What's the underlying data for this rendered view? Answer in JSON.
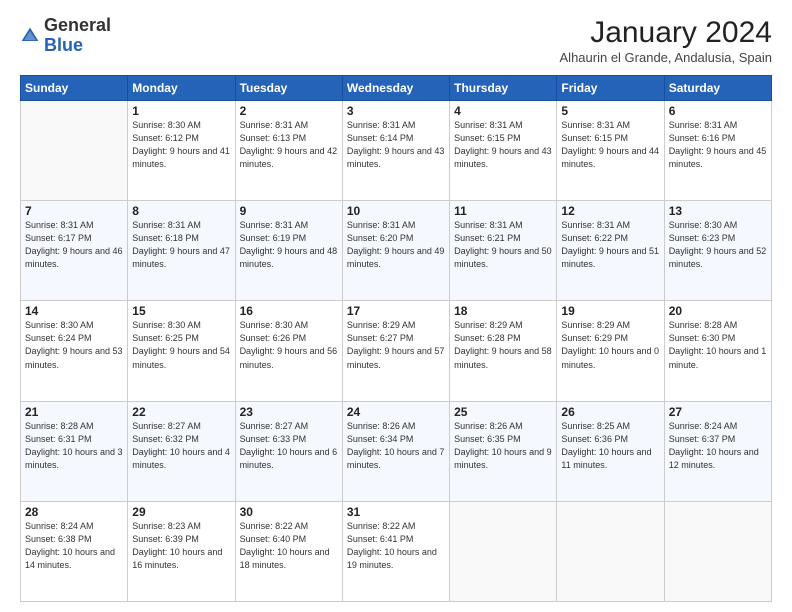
{
  "logo": {
    "general": "General",
    "blue": "Blue"
  },
  "header": {
    "month": "January 2024",
    "location": "Alhaurin el Grande, Andalusia, Spain"
  },
  "weekdays": [
    "Sunday",
    "Monday",
    "Tuesday",
    "Wednesday",
    "Thursday",
    "Friday",
    "Saturday"
  ],
  "weeks": [
    [
      {
        "day": "",
        "sunrise": "",
        "sunset": "",
        "daylight": ""
      },
      {
        "day": "1",
        "sunrise": "Sunrise: 8:30 AM",
        "sunset": "Sunset: 6:12 PM",
        "daylight": "Daylight: 9 hours and 41 minutes."
      },
      {
        "day": "2",
        "sunrise": "Sunrise: 8:31 AM",
        "sunset": "Sunset: 6:13 PM",
        "daylight": "Daylight: 9 hours and 42 minutes."
      },
      {
        "day": "3",
        "sunrise": "Sunrise: 8:31 AM",
        "sunset": "Sunset: 6:14 PM",
        "daylight": "Daylight: 9 hours and 43 minutes."
      },
      {
        "day": "4",
        "sunrise": "Sunrise: 8:31 AM",
        "sunset": "Sunset: 6:15 PM",
        "daylight": "Daylight: 9 hours and 43 minutes."
      },
      {
        "day": "5",
        "sunrise": "Sunrise: 8:31 AM",
        "sunset": "Sunset: 6:15 PM",
        "daylight": "Daylight: 9 hours and 44 minutes."
      },
      {
        "day": "6",
        "sunrise": "Sunrise: 8:31 AM",
        "sunset": "Sunset: 6:16 PM",
        "daylight": "Daylight: 9 hours and 45 minutes."
      }
    ],
    [
      {
        "day": "7",
        "sunrise": "Sunrise: 8:31 AM",
        "sunset": "Sunset: 6:17 PM",
        "daylight": "Daylight: 9 hours and 46 minutes."
      },
      {
        "day": "8",
        "sunrise": "Sunrise: 8:31 AM",
        "sunset": "Sunset: 6:18 PM",
        "daylight": "Daylight: 9 hours and 47 minutes."
      },
      {
        "day": "9",
        "sunrise": "Sunrise: 8:31 AM",
        "sunset": "Sunset: 6:19 PM",
        "daylight": "Daylight: 9 hours and 48 minutes."
      },
      {
        "day": "10",
        "sunrise": "Sunrise: 8:31 AM",
        "sunset": "Sunset: 6:20 PM",
        "daylight": "Daylight: 9 hours and 49 minutes."
      },
      {
        "day": "11",
        "sunrise": "Sunrise: 8:31 AM",
        "sunset": "Sunset: 6:21 PM",
        "daylight": "Daylight: 9 hours and 50 minutes."
      },
      {
        "day": "12",
        "sunrise": "Sunrise: 8:31 AM",
        "sunset": "Sunset: 6:22 PM",
        "daylight": "Daylight: 9 hours and 51 minutes."
      },
      {
        "day": "13",
        "sunrise": "Sunrise: 8:30 AM",
        "sunset": "Sunset: 6:23 PM",
        "daylight": "Daylight: 9 hours and 52 minutes."
      }
    ],
    [
      {
        "day": "14",
        "sunrise": "Sunrise: 8:30 AM",
        "sunset": "Sunset: 6:24 PM",
        "daylight": "Daylight: 9 hours and 53 minutes."
      },
      {
        "day": "15",
        "sunrise": "Sunrise: 8:30 AM",
        "sunset": "Sunset: 6:25 PM",
        "daylight": "Daylight: 9 hours and 54 minutes."
      },
      {
        "day": "16",
        "sunrise": "Sunrise: 8:30 AM",
        "sunset": "Sunset: 6:26 PM",
        "daylight": "Daylight: 9 hours and 56 minutes."
      },
      {
        "day": "17",
        "sunrise": "Sunrise: 8:29 AM",
        "sunset": "Sunset: 6:27 PM",
        "daylight": "Daylight: 9 hours and 57 minutes."
      },
      {
        "day": "18",
        "sunrise": "Sunrise: 8:29 AM",
        "sunset": "Sunset: 6:28 PM",
        "daylight": "Daylight: 9 hours and 58 minutes."
      },
      {
        "day": "19",
        "sunrise": "Sunrise: 8:29 AM",
        "sunset": "Sunset: 6:29 PM",
        "daylight": "Daylight: 10 hours and 0 minutes."
      },
      {
        "day": "20",
        "sunrise": "Sunrise: 8:28 AM",
        "sunset": "Sunset: 6:30 PM",
        "daylight": "Daylight: 10 hours and 1 minute."
      }
    ],
    [
      {
        "day": "21",
        "sunrise": "Sunrise: 8:28 AM",
        "sunset": "Sunset: 6:31 PM",
        "daylight": "Daylight: 10 hours and 3 minutes."
      },
      {
        "day": "22",
        "sunrise": "Sunrise: 8:27 AM",
        "sunset": "Sunset: 6:32 PM",
        "daylight": "Daylight: 10 hours and 4 minutes."
      },
      {
        "day": "23",
        "sunrise": "Sunrise: 8:27 AM",
        "sunset": "Sunset: 6:33 PM",
        "daylight": "Daylight: 10 hours and 6 minutes."
      },
      {
        "day": "24",
        "sunrise": "Sunrise: 8:26 AM",
        "sunset": "Sunset: 6:34 PM",
        "daylight": "Daylight: 10 hours and 7 minutes."
      },
      {
        "day": "25",
        "sunrise": "Sunrise: 8:26 AM",
        "sunset": "Sunset: 6:35 PM",
        "daylight": "Daylight: 10 hours and 9 minutes."
      },
      {
        "day": "26",
        "sunrise": "Sunrise: 8:25 AM",
        "sunset": "Sunset: 6:36 PM",
        "daylight": "Daylight: 10 hours and 11 minutes."
      },
      {
        "day": "27",
        "sunrise": "Sunrise: 8:24 AM",
        "sunset": "Sunset: 6:37 PM",
        "daylight": "Daylight: 10 hours and 12 minutes."
      }
    ],
    [
      {
        "day": "28",
        "sunrise": "Sunrise: 8:24 AM",
        "sunset": "Sunset: 6:38 PM",
        "daylight": "Daylight: 10 hours and 14 minutes."
      },
      {
        "day": "29",
        "sunrise": "Sunrise: 8:23 AM",
        "sunset": "Sunset: 6:39 PM",
        "daylight": "Daylight: 10 hours and 16 minutes."
      },
      {
        "day": "30",
        "sunrise": "Sunrise: 8:22 AM",
        "sunset": "Sunset: 6:40 PM",
        "daylight": "Daylight: 10 hours and 18 minutes."
      },
      {
        "day": "31",
        "sunrise": "Sunrise: 8:22 AM",
        "sunset": "Sunset: 6:41 PM",
        "daylight": "Daylight: 10 hours and 19 minutes."
      },
      {
        "day": "",
        "sunrise": "",
        "sunset": "",
        "daylight": ""
      },
      {
        "day": "",
        "sunrise": "",
        "sunset": "",
        "daylight": ""
      },
      {
        "day": "",
        "sunrise": "",
        "sunset": "",
        "daylight": ""
      }
    ]
  ]
}
